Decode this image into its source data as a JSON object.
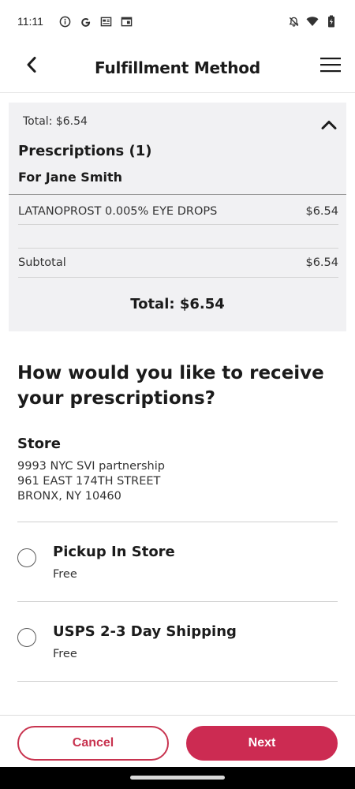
{
  "status_bar": {
    "time": "11:11",
    "left_icons": [
      "info-icon",
      "google-icon",
      "news-icon",
      "window-icon"
    ],
    "right_icons": [
      "bell-off-icon",
      "wifi-icon",
      "battery-icon"
    ]
  },
  "header": {
    "title": "Fulfillment Method",
    "back_icon": "chevron-left-icon",
    "menu_icon": "hamburger-menu-icon"
  },
  "summary": {
    "total_collapsed": "Total: $6.54",
    "section_title": "Prescriptions (1)",
    "patient": "For Jane Smith",
    "items": [
      {
        "name": "LATANOPROST 0.005% EYE DROPS",
        "price": "$6.54"
      }
    ],
    "subtotal_label": "Subtotal",
    "subtotal_value": "$6.54",
    "grand_total": "Total: $6.54"
  },
  "receive": {
    "question": "How would you like to receive your prescriptions?",
    "store_label": "Store",
    "store_address": [
      "9993 NYC SVI partnership",
      "961 EAST 174TH STREET",
      "BRONX, NY 10460"
    ],
    "options": [
      {
        "title": "Pickup In Store",
        "subtitle": "Free"
      },
      {
        "title": "USPS 2-3 Day Shipping",
        "subtitle": "Free"
      }
    ]
  },
  "actions": {
    "cancel_label": "Cancel",
    "next_label": "Next"
  },
  "colors": {
    "accent": "#cc2b52",
    "panel_bg": "#f1f1f3",
    "text": "#1b1b1b"
  }
}
